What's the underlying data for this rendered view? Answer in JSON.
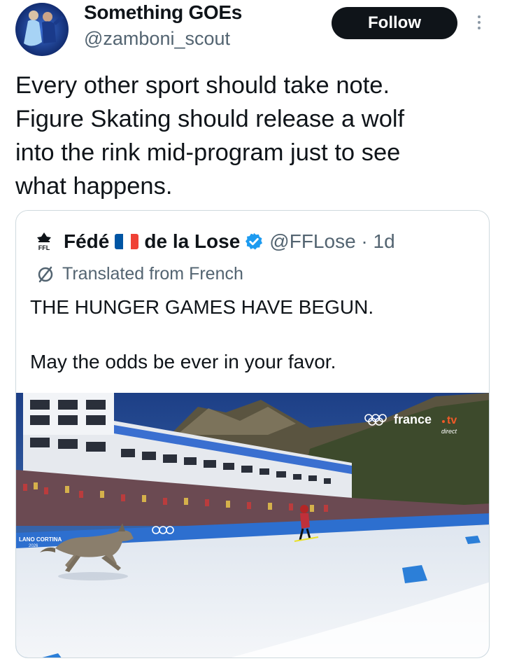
{
  "author": {
    "name": "Something GOEs",
    "handle": "@zamboni_scout",
    "follow_label": "Follow"
  },
  "tweet": {
    "lines": [
      "Every other sport should take note.",
      "Figure Skating should release a wolf",
      "into the rink mid-program just to see",
      "what happens."
    ]
  },
  "quote": {
    "name_part1": "Fédé",
    "name_part2": "de la Lose",
    "handle_time": "@FFLose · 1d",
    "logo_text": "FFL",
    "translated_label": "Translated from French",
    "line1": "THE HUNGER GAMES HAVE BEGUN.",
    "line2": "May the odds be ever in your favor.",
    "flag_colors": [
      "#0055a4",
      "#ffffff",
      "#ef4135"
    ],
    "verified_color": "#1d9bf0"
  },
  "media": {
    "broadcaster": "france",
    "broadcaster_suffix": "tv",
    "broadcaster_sub": "direct",
    "banner_text": "LANO CORTINA",
    "banner_year": "2026"
  },
  "icons": {
    "more": "more-vertical-icon",
    "verified": "verified-badge-icon",
    "translate": "translate-icon",
    "logo": "ffl-logo-icon",
    "olympic": "olympic-rings-icon"
  }
}
